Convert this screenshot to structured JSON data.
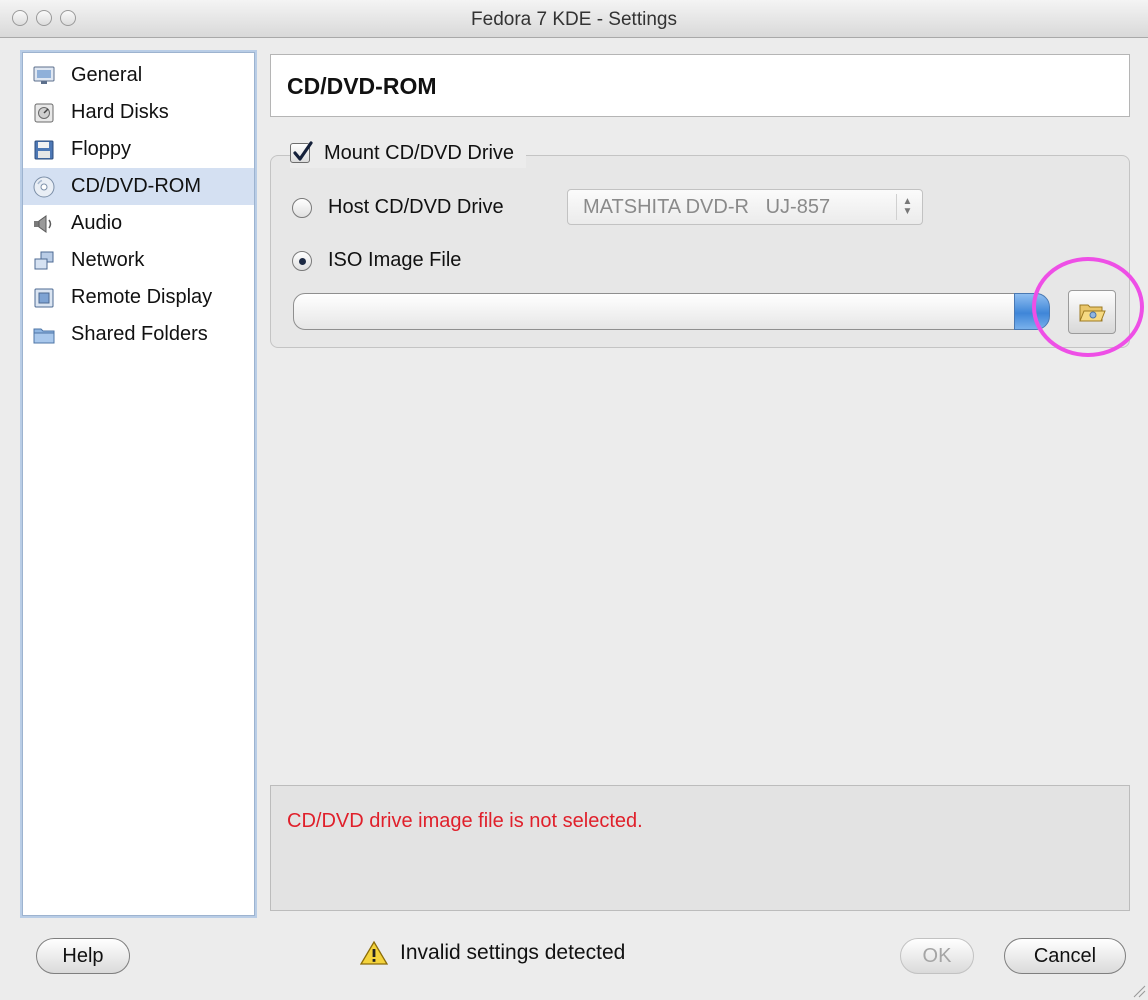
{
  "window": {
    "title": "Fedora 7 KDE - Settings"
  },
  "sidebar": {
    "items": [
      {
        "label": "General",
        "icon": "monitor-icon"
      },
      {
        "label": "Hard Disks",
        "icon": "hard-disk-icon"
      },
      {
        "label": "Floppy",
        "icon": "floppy-icon"
      },
      {
        "label": "CD/DVD-ROM",
        "icon": "cd-icon",
        "selected": true
      },
      {
        "label": "Audio",
        "icon": "speaker-icon"
      },
      {
        "label": "Network",
        "icon": "network-icon"
      },
      {
        "label": "Remote Display",
        "icon": "remote-display-icon"
      },
      {
        "label": "Shared Folders",
        "icon": "folder-icon"
      }
    ]
  },
  "page": {
    "title": "CD/DVD-ROM"
  },
  "mount_group": {
    "checkbox_label": "Mount CD/DVD Drive",
    "checked": true,
    "host_drive_label": "Host CD/DVD Drive",
    "host_drive_selected": false,
    "host_drive_value": "MATSHITA DVD-R   UJ-857",
    "iso_label": "ISO Image File",
    "iso_selected": true,
    "iso_path": ""
  },
  "message": {
    "text": "CD/DVD drive image file is not selected.",
    "color": "#e0202b"
  },
  "footer": {
    "help_label": "Help",
    "status_text": "Invalid settings detected",
    "ok_label": "OK",
    "cancel_label": "Cancel"
  },
  "colors": {
    "selection": "#d4e0f2",
    "highlight_ring": "#ee4fe6",
    "accent_blue": "#3f86d8"
  }
}
